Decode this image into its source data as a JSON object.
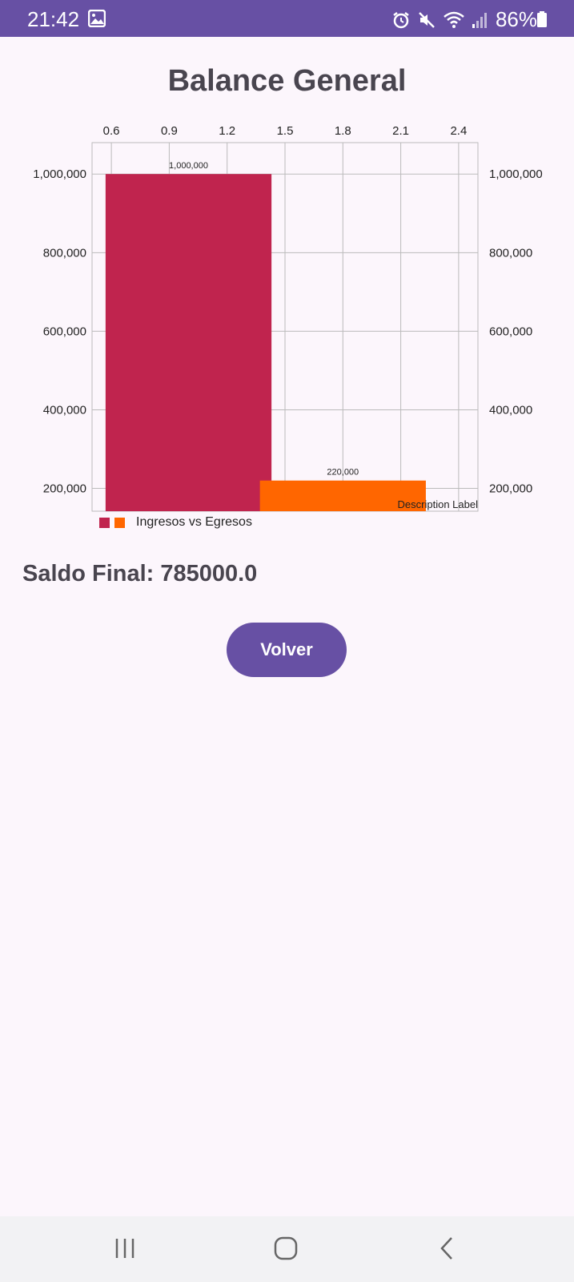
{
  "status_bar": {
    "time": "21:42",
    "battery": "86%",
    "icons": [
      "gallery-icon",
      "alarm-icon",
      "mute-icon",
      "wifi-icon",
      "signal-icon",
      "battery-icon"
    ]
  },
  "screen": {
    "title": "Balance General",
    "saldo_label": "Saldo Final:",
    "saldo_value": "785000.0",
    "button_label": "Volver"
  },
  "chart_data": {
    "type": "bar",
    "categories": [
      "Ingresos",
      "Egresos"
    ],
    "x": [
      1.0,
      1.8
    ],
    "values": [
      1000000,
      220000
    ],
    "value_labels": [
      "1,000,000",
      "220,000"
    ],
    "colors": [
      "#c0244e",
      "#ff6600"
    ],
    "x_ticks": [
      "0.6",
      "0.9",
      "1.2",
      "1.5",
      "1.8",
      "2.1",
      "2.4"
    ],
    "x_tick_values": [
      0.6,
      0.9,
      1.2,
      1.5,
      1.8,
      2.1,
      2.4
    ],
    "y_ticks": [
      "1,000,000",
      "800,000",
      "600,000",
      "400,000",
      "200,000"
    ],
    "y_tick_values": [
      1000000,
      800000,
      600000,
      400000,
      200000
    ],
    "xlim": [
      0.5,
      2.5
    ],
    "ylim": [
      142000,
      1080000
    ],
    "legend_label": "Ingresos vs Egresos",
    "legend_position": "bottom-left",
    "description": "Description Label",
    "grid": true
  }
}
